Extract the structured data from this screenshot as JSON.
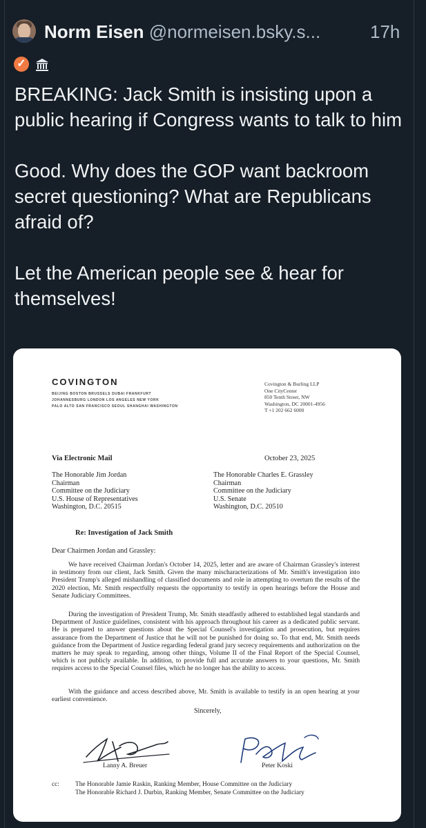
{
  "post": {
    "author_name": "Norm Eisen",
    "author_handle": "@normeisen.bsky.s...",
    "time": "17h",
    "text": "BREAKING: Jack Smith is insisting upon a public hearing if Congress wants to talk to him\n\nGood. Why does the GOP want backroom secret questioning? What are Republicans afraid of?\n\nLet the American people see & hear for themselves!",
    "badges": [
      "verified-check-icon",
      "government-building-icon"
    ],
    "colors": {
      "background": "#161e27",
      "text": "#f1f3f5",
      "muted": "#aebbc9",
      "verified": "#f27a43"
    }
  },
  "letter": {
    "firm_name": "COVINGTON",
    "offices": [
      "BEIJING  BOSTON  BRUSSELS  DUBAI  FRANKFURT",
      "JOHANNESBURG  LONDON  LOS ANGELES  NEW YORK",
      "PALO ALTO  SAN FRANCISCO  SEOUL  SHANGHAI  WASHINGTON"
    ],
    "firm_address": [
      "Covington & Burling LLP",
      "One CityCenter",
      "850 Tenth Street, NW",
      "Washington, DC 20001-4956",
      "T  +1 202 662 6000"
    ],
    "delivery": "Via Electronic Mail",
    "date": "October 23, 2025",
    "recipient_left": [
      "The Honorable Jim Jordan",
      "Chairman",
      "Committee on the Judiciary",
      "U.S. House of Representatives",
      "Washington, D.C. 20515"
    ],
    "recipient_right": [
      "The Honorable Charles E. Grassley",
      "Chairman",
      "Committee on the Judiciary",
      "U.S. Senate",
      "Washington, D.C. 20510"
    ],
    "subject": "Re:  Investigation of Jack Smith",
    "salutation": "Dear Chairmen Jordan and Grassley:",
    "paragraphs": [
      "We have received Chairman Jordan's October 14, 2025, letter and are aware of Chairman Grassley's interest in testimony from our client, Jack Smith.  Given the many mischaracterizations of Mr. Smith's investigation into President Trump's alleged mishandling of classified documents and role in attempting to overturn the results of the 2020 election, Mr. Smith respectfully requests the opportunity to testify in open hearings before the House and Senate Judiciary Committees.",
      "During the investigation of President Trump, Mr. Smith steadfastly adhered to established legal standards and Department of Justice guidelines, consistent with his approach throughout his career as a dedicated public servant.  He is prepared to answer questions about the Special Counsel's investigation and prosecution, but requires assurance from the Department of Justice that he will not be punished for doing so.  To that end, Mr. Smith needs guidance from the Department of Justice regarding federal grand jury secrecy requirements and authorization on the matters he may speak to regarding, among other things, Volume II of the Final Report of the Special Counsel, which is not publicly available.  In addition, to provide full and accurate answers to your questions, Mr. Smith requires access to the Special Counsel files, which he no longer has the ability to access.",
      "With the guidance and access described above, Mr. Smith is available to testify in an open hearing at your earliest convenience."
    ],
    "closing": "Sincerely,",
    "signers": [
      "Lanny A. Breuer",
      "Peter Koski"
    ],
    "cc_label": "cc:",
    "cc": [
      "The Honorable Jamie Raskin, Ranking Member, House Committee on the Judiciary",
      "The Honorable Richard J. Durbin, Ranking Member, Senate Committee on the Judiciary"
    ]
  }
}
